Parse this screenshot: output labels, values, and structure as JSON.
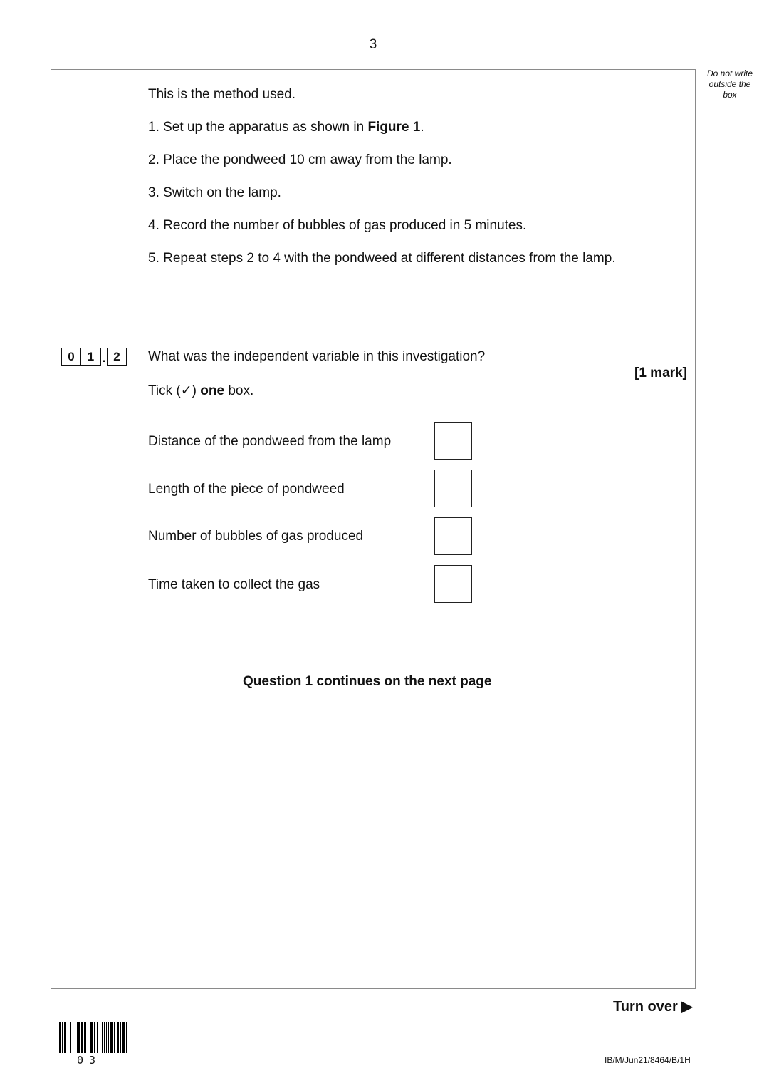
{
  "page_number": "3",
  "margin_note": "Do not write outside the box",
  "method": {
    "intro": "This is the method used.",
    "steps": [
      {
        "pre": "1. Set up the apparatus as shown in ",
        "bold": "Figure 1",
        "post": "."
      },
      {
        "text": "2. Place the pondweed 10 cm away from the lamp."
      },
      {
        "text": "3. Switch on the lamp."
      },
      {
        "text": "4. Record the number of bubbles of gas produced in 5 minutes."
      },
      {
        "text": "5. Repeat steps 2 to 4 with the pondweed at different distances from the lamp."
      }
    ]
  },
  "question": {
    "number_digits": [
      "0",
      "1"
    ],
    "separator": ".",
    "sub_number": "2",
    "text": "What was the independent variable in this investigation?",
    "marks": "[1 mark]",
    "instruction_pre": "Tick (✓) ",
    "instruction_bold": "one",
    "instruction_post": " box.",
    "options": [
      {
        "label": "Distance of the pondweed from the lamp",
        "checked": false
      },
      {
        "label": "Length of the piece of pondweed",
        "checked": false
      },
      {
        "label": "Number of bubbles of gas produced",
        "checked": false
      },
      {
        "label": "Time taken to collect the gas",
        "checked": false
      }
    ]
  },
  "continues_note": "Question 1 continues on the next page",
  "footer": {
    "turn_over": "Turn over ▶",
    "barcode_number": "03",
    "paper_code": "IB/M/Jun21/8464/B/1H"
  }
}
